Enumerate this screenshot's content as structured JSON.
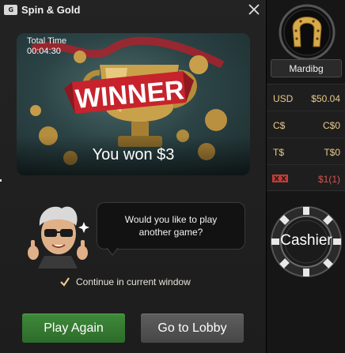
{
  "window": {
    "title": "Spin & Gold",
    "app_icon_text": "G"
  },
  "banner": {
    "total_time_label": "Total Time",
    "total_time_value": "00:04:30",
    "ribbon_text": "WINNER",
    "won_text": "You won $3"
  },
  "prompt": {
    "question": "Would you like to play another game?",
    "continue_label": "Continue in current window",
    "continue_checked": true
  },
  "actions": {
    "play_again": "Play Again",
    "go_to_lobby": "Go to Lobby"
  },
  "account": {
    "username": "Mardibg",
    "balances": [
      {
        "currency": "USD",
        "amount": "$50.04"
      },
      {
        "currency": "C$",
        "amount": "C$0"
      },
      {
        "currency": "T$",
        "amount": "T$0"
      },
      {
        "currency": "tickets-icon",
        "amount": "$1(1)"
      }
    ],
    "cashier_label": "Cashier"
  },
  "colors": {
    "play_button": "#2f6e2c",
    "lobby_button": "#525252",
    "gold": "#e9c98a",
    "ticket_red": "#d9534f"
  }
}
